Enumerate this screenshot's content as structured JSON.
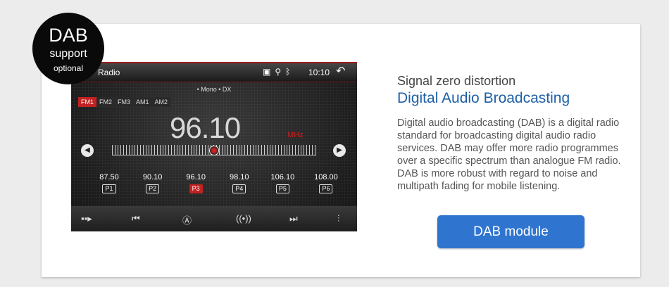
{
  "badge": {
    "line1": "DAB",
    "line2": "support",
    "line3": "optional"
  },
  "radio": {
    "app_title": "Radio",
    "status_icons": [
      "sd-card-icon",
      "location-icon",
      "bluetooth-icon"
    ],
    "clock": "10:10",
    "flags": "• Mono  • DX",
    "bands": [
      "FM1",
      "FM2",
      "FM3",
      "AM1",
      "AM2"
    ],
    "active_band": "FM1",
    "frequency": "96.10",
    "unit": "MHz",
    "presets": [
      {
        "freq": "87.50",
        "label": "P1"
      },
      {
        "freq": "90.10",
        "label": "P2"
      },
      {
        "freq": "96.10",
        "label": "P3"
      },
      {
        "freq": "98.10",
        "label": "P4"
      },
      {
        "freq": "106.10",
        "label": "P5"
      },
      {
        "freq": "108.00",
        "label": "P6"
      }
    ],
    "active_preset": "P3"
  },
  "text": {
    "subtitle": "Signal zero distortion",
    "title": "Digital Audio Broadcasting",
    "description": "Digital audio broadcasting (DAB) is a digital radio standard for broadcasting digital audio radio services. DAB may offer more radio programmes over a specific spectrum than analogue FM radio. DAB is more robust with regard to noise and multipath fading for mobile listening.",
    "button": "DAB module"
  },
  "colors": {
    "accent": "#2f75cf",
    "title": "#1e5fa8",
    "radio_red": "#c22222"
  }
}
